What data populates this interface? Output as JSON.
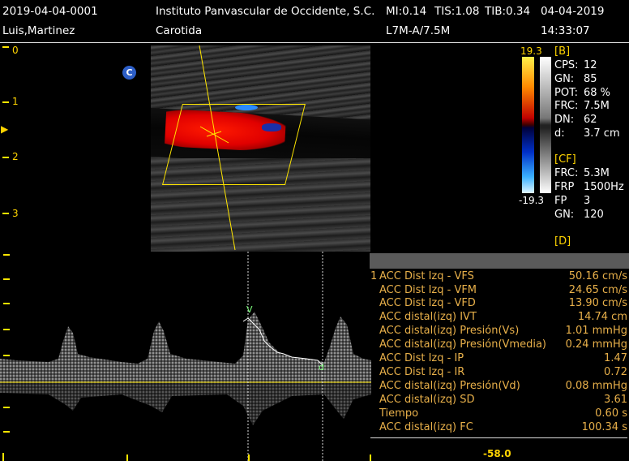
{
  "header": {
    "patient_id": "2019-04-04-0001",
    "patient_name": "Luis,Martinez",
    "institution": "Instituto Panvascular de Occidente, S.C.",
    "mi": "MI:0.14",
    "tis": "TIS:1.08",
    "tib": "TIB:0.34",
    "date": "04-04-2019",
    "exam": "Carotida",
    "probe": "L7M-A/7.5M",
    "time": "14:33:07"
  },
  "depth_scale": {
    "labels": [
      "0",
      "1",
      "2",
      "3"
    ],
    "focus_marker": "▶"
  },
  "orientation_marker": "C",
  "color_scale": {
    "top": "19.3",
    "bottom": "-19.3"
  },
  "b_params": {
    "section": "[B]",
    "rows": [
      {
        "k": "CPS:",
        "v": "12"
      },
      {
        "k": "GN:",
        "v": "85"
      },
      {
        "k": "POT:",
        "v": "68 %"
      },
      {
        "k": "FRC:",
        "v": "7.5M"
      },
      {
        "k": "DN:",
        "v": "62"
      },
      {
        "k": "d:",
        "v": "3.7 cm"
      }
    ]
  },
  "cf_params": {
    "section": "[CF]",
    "rows": [
      {
        "k": "FRC:",
        "v": "5.3M"
      },
      {
        "k": "FRP",
        "v": "1500Hz"
      },
      {
        "k": "FP",
        "v": "3"
      },
      {
        "k": "GN:",
        "v": "120"
      }
    ]
  },
  "d_params": {
    "section": "[D]"
  },
  "measurements": {
    "index": "1",
    "rows": [
      {
        "k": "ACC Dist Izq - VFS",
        "v": "50.16 cm/s"
      },
      {
        "k": "ACC Dist Izq - VFM",
        "v": "24.65 cm/s"
      },
      {
        "k": "ACC Dist Izq - VFD",
        "v": "13.90 cm/s"
      },
      {
        "k": "ACC distal(izq) IVT",
        "v": "14.74 cm"
      },
      {
        "k": "ACC distal(izq) Presión(Vs)",
        "v": "1.01 mmHg"
      },
      {
        "k": "ACC distal(izq) Presión(Vmedia)",
        "v": "0.24 mmHg"
      },
      {
        "k": "ACC Dist Izq - IP",
        "v": "1.47"
      },
      {
        "k": "ACC Dist Izq - IR",
        "v": "0.72"
      },
      {
        "k": "ACC distal(izq) Presión(Vd)",
        "v": "0.08 mmHg"
      },
      {
        "k": "ACC distal(izq) SD",
        "v": "3.61"
      },
      {
        "k": "Tiempo",
        "v": "0.60 s"
      },
      {
        "k": "ACC distal(izq) FC",
        "v": "100.34 s"
      }
    ]
  },
  "velocity_bottom_label": "-58.0",
  "cursor_marks": {
    "systolic": "V",
    "diastolic": "d"
  },
  "colors": {
    "accent_yellow": "#ffe600",
    "text_orange": "#e8b04a",
    "flow_red": "#e00000",
    "flow_blue": "#1e6bff"
  }
}
